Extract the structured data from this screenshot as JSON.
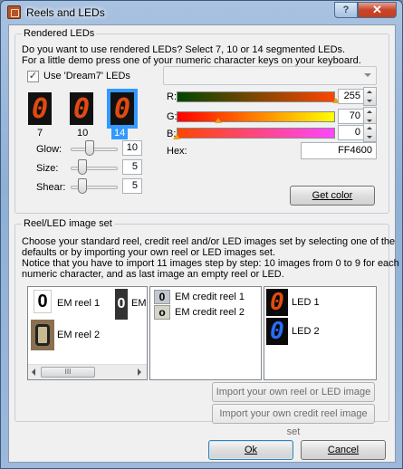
{
  "window": {
    "title": "Reels and LEDs",
    "help_label": "?",
    "close_label": "✕"
  },
  "rendered_leds": {
    "legend": "Rendered LEDs",
    "description_line1": "Do you want to use rendered LEDs? Select 7, 10 or 14 segmented LEDs.",
    "description_line2": "For a little demo press one of your numeric character keys on your keyboard.",
    "use_dream7_label": "Use 'Dream7' LEDs",
    "use_dream7_checked": true,
    "combo_value": "",
    "segments": [
      {
        "digit": "0",
        "label": "7",
        "selected": false
      },
      {
        "digit": "0",
        "label": "10",
        "selected": false
      },
      {
        "digit": "0",
        "label": "14",
        "selected": true
      }
    ],
    "glow": {
      "label": "Glow:",
      "value": "10",
      "level": 0.4
    },
    "size": {
      "label": "Size:",
      "value": "5",
      "level": 0.2
    },
    "shear": {
      "label": "Shear:",
      "value": "5",
      "level": 0.2
    },
    "r": {
      "label": "R:",
      "value": "255",
      "level": 1.0
    },
    "g": {
      "label": "G:",
      "value": "70",
      "level": 0.27
    },
    "b": {
      "label": "B:",
      "value": "0",
      "level": 0.0
    },
    "hex": {
      "label": "Hex:",
      "value": "FF4600"
    },
    "get_color_label": "Get color",
    "accent": "#ff4600"
  },
  "reel_set": {
    "legend": "Reel/LED image set",
    "description_1": "Choose your standard reel, credit reel and/or LED images set by selecting one of the",
    "description_2": "defaults or by importing your own reel or LED images set.",
    "description_3": "Notice that you have to import 11 images step by step: 10 images from 0 to 9 for each",
    "description_4": "numeric character, and as last image an empty reel or LED.",
    "reels": [
      {
        "name": "EM reel 1",
        "icon": "white-reel-icon"
      },
      {
        "name": "EM reel 2",
        "icon": "brown-reel-icon"
      },
      {
        "name": "EM",
        "icon": "dark-reel-icon"
      }
    ],
    "credit_reels": [
      {
        "name": "EM credit reel 1",
        "icon": "credit-reel-icon"
      },
      {
        "name": "EM credit reel 2",
        "icon": "credit-reel-icon"
      }
    ],
    "leds": [
      {
        "name": "LED 1",
        "digit": "0",
        "color": "#e24a10"
      },
      {
        "name": "LED 2",
        "digit": "0",
        "color": "#2a6cff"
      }
    ],
    "scroll_thumb_label": "III",
    "import_reel_label": "Import your own reel or LED image set",
    "import_credit_label": "Import your own credit reel image set"
  },
  "footer": {
    "ok_label": "Ok",
    "cancel_label": "Cancel"
  }
}
